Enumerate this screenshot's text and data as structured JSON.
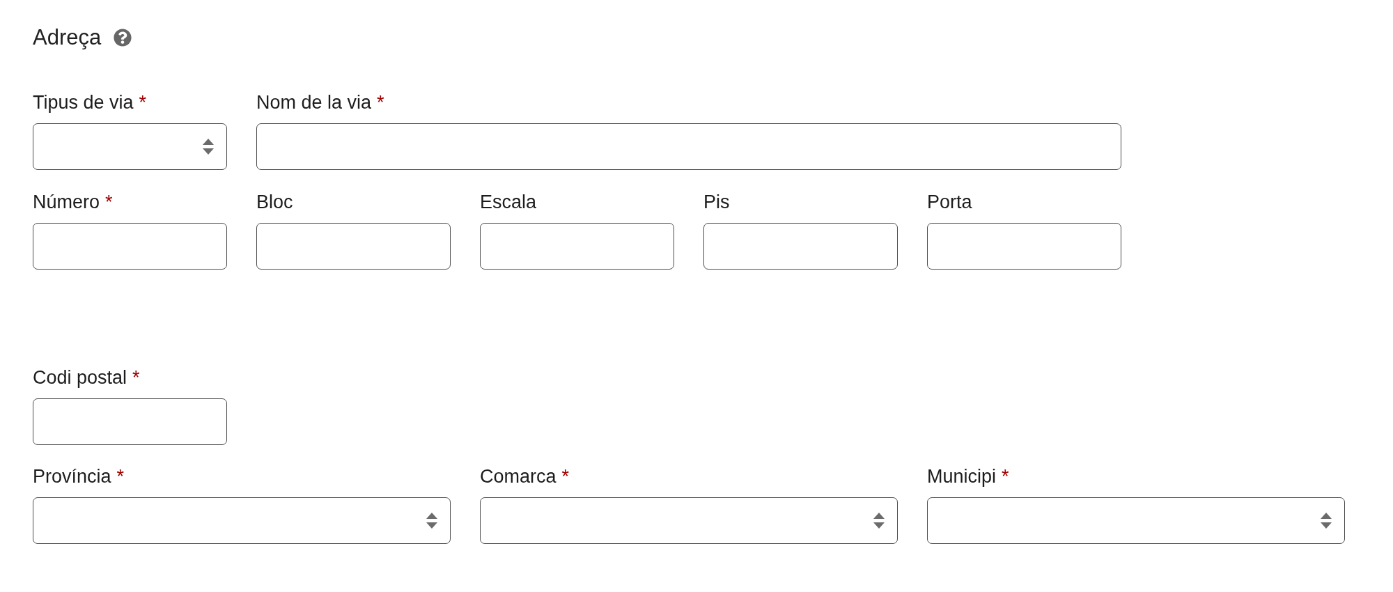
{
  "section": {
    "title": "Adreça"
  },
  "rows": [
    {
      "fields": [
        {
          "label": "Tipus de via",
          "required_mark": "*",
          "kind": "select"
        },
        {
          "label": "Nom de la via",
          "required_mark": "*",
          "kind": "text"
        }
      ]
    },
    {
      "fields": [
        {
          "label": "Número",
          "required_mark": "*",
          "kind": "text"
        },
        {
          "label": "Bloc",
          "kind": "text"
        },
        {
          "label": "Escala",
          "kind": "text"
        },
        {
          "label": "Pis",
          "kind": "text"
        },
        {
          "label": "Porta",
          "kind": "text"
        }
      ]
    },
    {
      "fields": [
        {
          "label": "Codi postal",
          "required_mark": "*",
          "kind": "text"
        }
      ]
    },
    {
      "fields": [
        {
          "label": "Província",
          "required_mark": "*",
          "kind": "select"
        },
        {
          "label": "Comarca",
          "required_mark": "*",
          "kind": "select"
        },
        {
          "label": "Municipi",
          "required_mark": "*",
          "kind": "select"
        }
      ]
    }
  ]
}
